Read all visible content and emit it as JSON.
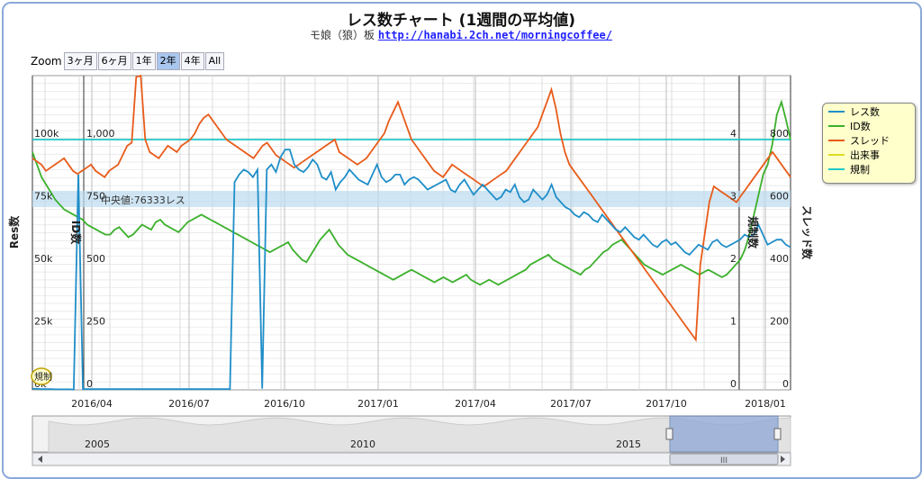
{
  "title": "レス数チャート (1週間の平均値)",
  "subtitle": {
    "prefix": "モ娘（狼）板",
    "url": "http://hanabi.2ch.net/morningcoffee/"
  },
  "zoom": {
    "label": "Zoom",
    "buttons": [
      "3ヶ月",
      "6ヶ月",
      "1年",
      "2年",
      "4年",
      "All"
    ],
    "active": "2年"
  },
  "colors": {
    "res": "#1f8ec8",
    "id": "#3bb02b",
    "thread": "#e85b1a",
    "event": "#dddd20",
    "regulation": "#20c8c8"
  },
  "chart_data": {
    "type": "line",
    "axes": {
      "res": {
        "label": "Res数",
        "ticks": [
          "0k",
          "25k",
          "50k",
          "75k",
          "100k"
        ],
        "range": [
          0,
          100000
        ]
      },
      "id": {
        "label": "ID数",
        "ticks": [
          "0",
          "250",
          "500",
          "750",
          "1,000"
        ],
        "range": [
          0,
          1000
        ]
      },
      "regulation": {
        "label": "規制数",
        "ticks": [
          "0",
          "1",
          "2",
          "3",
          "4"
        ],
        "range": [
          0,
          4
        ]
      },
      "thread": {
        "label": "スレッド数",
        "ticks": [
          "0",
          "200",
          "400",
          "600",
          "800"
        ],
        "range": [
          0,
          800
        ]
      }
    },
    "x_ticks": [
      "2016/04",
      "2016/07",
      "2016/10",
      "2017/01",
      "2017/04",
      "2017/07",
      "2017/10",
      "2018/01"
    ],
    "median_label": "中央値:76333レス",
    "median_band": [
      73000,
      79500
    ],
    "event_label": "規制",
    "series": [
      {
        "name": "レス数",
        "axis": "res",
        "values": [
          500,
          400,
          300,
          300,
          300,
          200,
          200,
          200,
          200,
          100,
          86000,
          300,
          300,
          300,
          300,
          300,
          300,
          300,
          300,
          300,
          300,
          300,
          300,
          300,
          300,
          300,
          300,
          300,
          300,
          300,
          300,
          300,
          300,
          300,
          300,
          300,
          300,
          300,
          300,
          300,
          300,
          300,
          300,
          300,
          83000,
          86000,
          88000,
          87000,
          85000,
          88000,
          500,
          88000,
          90000,
          87000,
          93000,
          96000,
          96000,
          90000,
          88000,
          87000,
          89000,
          92000,
          90000,
          85000,
          84000,
          87000,
          80000,
          83000,
          85000,
          88000,
          86000,
          84000,
          83000,
          82000,
          86000,
          90000,
          85000,
          83000,
          84000,
          86000,
          86000,
          82000,
          84000,
          85000,
          84000,
          82000,
          80000,
          81000,
          82000,
          83000,
          84000,
          80000,
          79000,
          82000,
          84000,
          81000,
          78000,
          80000,
          82000,
          80000,
          78000,
          76000,
          77000,
          80000,
          79000,
          82000,
          77000,
          75000,
          76000,
          80000,
          78000,
          76000,
          78000,
          82000,
          77000,
          75000,
          73000,
          72000,
          70000,
          69000,
          71000,
          70000,
          68000,
          67000,
          70000,
          68000,
          66000,
          64000,
          63000,
          65000,
          63000,
          61000,
          60000,
          62000,
          60000,
          58000,
          57000,
          59000,
          60000,
          58000,
          59000,
          57000,
          55000,
          54000,
          56000,
          58000,
          57000,
          56000,
          59000,
          60000,
          58000,
          57000,
          58000,
          59000,
          60000,
          62000,
          61000,
          62000,
          66000,
          62000,
          58000,
          59000,
          60000,
          60000,
          58000,
          57000
        ]
      },
      {
        "name": "ID数",
        "axis": "id",
        "values": [
          950,
          900,
          850,
          820,
          790,
          760,
          740,
          720,
          710,
          700,
          690,
          680,
          660,
          650,
          640,
          630,
          620,
          620,
          640,
          650,
          630,
          610,
          620,
          640,
          660,
          650,
          640,
          670,
          680,
          660,
          650,
          640,
          630,
          650,
          670,
          680,
          690,
          700,
          690,
          680,
          670,
          660,
          650,
          640,
          630,
          620,
          610,
          600,
          590,
          580,
          570,
          560,
          550,
          560,
          570,
          580,
          590,
          560,
          540,
          520,
          510,
          540,
          570,
          600,
          620,
          640,
          610,
          580,
          560,
          540,
          530,
          520,
          510,
          500,
          490,
          480,
          470,
          460,
          450,
          440,
          450,
          460,
          470,
          480,
          470,
          460,
          450,
          440,
          430,
          440,
          450,
          440,
          430,
          440,
          450,
          460,
          440,
          430,
          420,
          430,
          440,
          430,
          420,
          430,
          440,
          450,
          460,
          470,
          480,
          500,
          510,
          520,
          530,
          540,
          520,
          510,
          500,
          490,
          480,
          470,
          460,
          480,
          490,
          510,
          530,
          550,
          560,
          580,
          590,
          600,
          580,
          560,
          540,
          520,
          500,
          490,
          480,
          470,
          460,
          470,
          480,
          490,
          500,
          490,
          480,
          470,
          460,
          470,
          480,
          470,
          460,
          450,
          460,
          480,
          500,
          520,
          560,
          620,
          700,
          780,
          860,
          900,
          980,
          1100,
          1150,
          1080,
          1000
        ]
      },
      {
        "name": "スレッド",
        "axis": "thread",
        "values": [
          740,
          730,
          720,
          700,
          710,
          720,
          730,
          740,
          720,
          700,
          690,
          700,
          710,
          720,
          700,
          690,
          680,
          700,
          710,
          720,
          750,
          780,
          790,
          1000,
          1100,
          800,
          760,
          750,
          740,
          760,
          780,
          770,
          760,
          780,
          790,
          800,
          820,
          850,
          870,
          880,
          860,
          840,
          820,
          800,
          790,
          780,
          770,
          760,
          750,
          740,
          760,
          780,
          790,
          770,
          750,
          740,
          730,
          720,
          710,
          720,
          730,
          740,
          750,
          760,
          770,
          780,
          790,
          800,
          760,
          750,
          740,
          730,
          720,
          730,
          740,
          760,
          780,
          800,
          820,
          860,
          890,
          920,
          880,
          840,
          800,
          780,
          760,
          740,
          720,
          700,
          690,
          680,
          700,
          720,
          710,
          700,
          690,
          680,
          670,
          660,
          650,
          660,
          670,
          680,
          690,
          700,
          720,
          740,
          760,
          780,
          800,
          820,
          840,
          880,
          920,
          960,
          900,
          820,
          760,
          720,
          700,
          680,
          660,
          640,
          620,
          600,
          580,
          560,
          540,
          520,
          500,
          480,
          460,
          440,
          420,
          400,
          380,
          360,
          340,
          320,
          300,
          280,
          260,
          240,
          220,
          200,
          180,
          160,
          400,
          500,
          600,
          650,
          640,
          630,
          620,
          610,
          600,
          620,
          640,
          660,
          680,
          700,
          720,
          740,
          760,
          740,
          720,
          700,
          680
        ]
      },
      {
        "name": "出来事",
        "axis": "id",
        "values": []
      },
      {
        "name": "規制",
        "axis": "regulation",
        "values": [
          4,
          4
        ]
      }
    ]
  },
  "navigator": {
    "labels": [
      "2005",
      "2010",
      "2015"
    ],
    "scroll_label": "III"
  }
}
